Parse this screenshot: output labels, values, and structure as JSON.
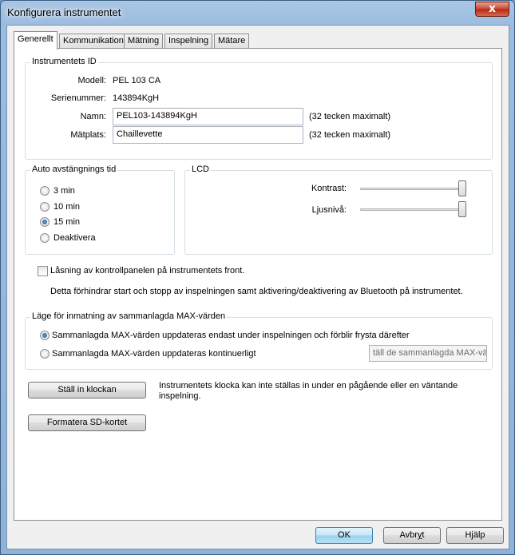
{
  "window": {
    "title": "Konfigurera instrumentet",
    "close_glyph": "x"
  },
  "tabs": [
    "Generellt",
    "Kommunikation",
    "Mätning",
    "Inspelning",
    "Mätare"
  ],
  "id_group": {
    "label": "Instrumentets ID",
    "model_label": "Modell:",
    "model_value": "PEL 103 CA",
    "serial_label": "Serienummer:",
    "serial_value": "143894KgH",
    "name_label": "Namn:",
    "name_value": "PEL103-143894KgH",
    "name_hint": "(32 tecken maximalt)",
    "location_label": "Mätplats:",
    "location_value": "Chaillevette",
    "location_hint": "(32 tecken maximalt)"
  },
  "auto_off": {
    "label": "Auto avstängnings tid",
    "options": [
      "3 min",
      "10 min",
      "15 min",
      "Deaktivera"
    ],
    "selected": 2
  },
  "lcd": {
    "label": "LCD",
    "contrast_label": "Kontrast:",
    "contrast_level": 1.0,
    "brightness_label": "Ljusnivå:",
    "brightness_level": 1.0
  },
  "lock": {
    "label": "Låsning av kontrollpanelen på instrumentets front.",
    "checked": false,
    "description": "Detta förhindrar start och stopp av inspelningen samt aktivering/deaktivering av Bluetooth på instrumentet."
  },
  "max_mode": {
    "label": "Läge för inmatning av sammanlagda MAX-värden",
    "option1": "Sammanlagda MAX-värden uppdateras endast under inspelningen och förblir frysta därefter",
    "option2": "Sammanlagda MAX-värden uppdateras kontinuerligt",
    "selected": 0,
    "disabled_field": "täll de sammanlagda MAX-värd"
  },
  "clock": {
    "button": "Ställ in klockan",
    "note_line1": "Instrumentets klocka kan inte ställas in under en pågående eller en väntande",
    "note_line2": "inspelning."
  },
  "sd": {
    "button": "Formatera SD-kortet"
  },
  "footer": {
    "ok": "OK",
    "cancel_pre": "Avbr",
    "cancel_u": "y",
    "cancel_post": "t",
    "help": "Hjälp"
  }
}
